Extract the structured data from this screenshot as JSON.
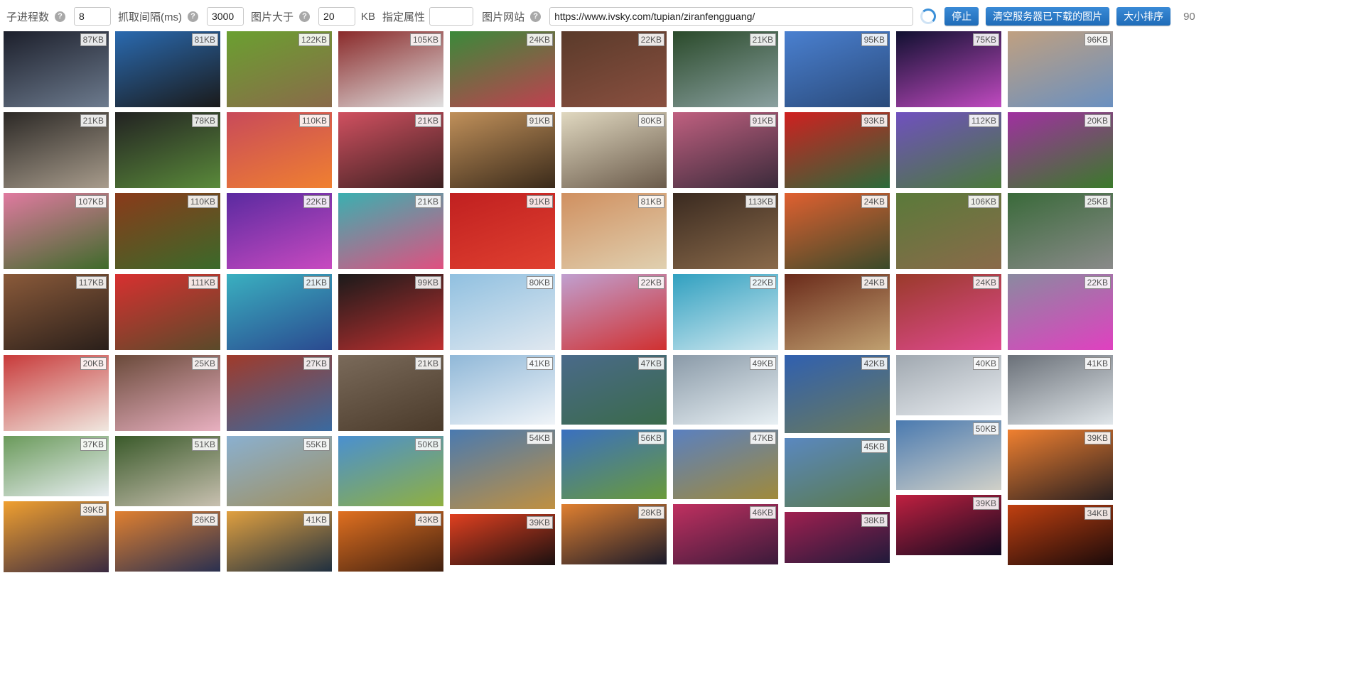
{
  "toolbar": {
    "threads_label": "子进程数",
    "threads_value": "8",
    "interval_label": "抓取间隔(ms)",
    "interval_value": "3000",
    "minsize_label": "图片大于",
    "minsize_value": "20",
    "minsize_unit": "KB",
    "attr_label": "指定属性",
    "attr_value": "",
    "url_label": "图片网站",
    "url_value": "https://www.ivsky.com/tupian/ziranfengguang/",
    "stop_label": "停止",
    "clear_label": "清空服务器已下载的图片",
    "sort_label": "大小排序",
    "count": "90",
    "help_glyph": "?",
    "help_icon": "question-circle-icon",
    "spinner_icon": "loading-spinner-icon"
  },
  "colors": {
    "button": "#2a7cc9",
    "spinner": "#3a8fd8"
  },
  "columns": [
    [
      {
        "size": "87KB",
        "h": 107,
        "c": [
          "#1c1f2b",
          "#6d7b8e"
        ]
      },
      {
        "size": "21KB",
        "h": 107,
        "c": [
          "#2c2926",
          "#a89c8c"
        ]
      },
      {
        "size": "107KB",
        "h": 107,
        "c": [
          "#e07aa0",
          "#3e6b2a"
        ]
      },
      {
        "size": "117KB",
        "h": 107,
        "c": [
          "#8a5a3a",
          "#2a1f1a"
        ]
      },
      {
        "size": "20KB",
        "h": 107,
        "c": [
          "#c83a3a",
          "#f0e8e0"
        ]
      },
      {
        "size": "37KB",
        "h": 85,
        "c": [
          "#6a9a5a",
          "#e8eef2"
        ]
      },
      {
        "size": "39KB",
        "h": 100,
        "c": [
          "#f0a030",
          "#3a2a40"
        ]
      }
    ],
    [
      {
        "size": "81KB",
        "h": 107,
        "c": [
          "#2a6ab0",
          "#1a1a1a"
        ]
      },
      {
        "size": "78KB",
        "h": 107,
        "c": [
          "#222222",
          "#5a8a3a"
        ]
      },
      {
        "size": "110KB",
        "h": 107,
        "c": [
          "#8a3a1a",
          "#3a6a2a"
        ]
      },
      {
        "size": "111KB",
        "h": 107,
        "c": [
          "#d83030",
          "#5a4a2a"
        ]
      },
      {
        "size": "25KB",
        "h": 107,
        "c": [
          "#6a4a3a",
          "#e8b0c0"
        ]
      },
      {
        "size": "51KB",
        "h": 99,
        "c": [
          "#3a5a2a",
          "#c8c0b0"
        ]
      },
      {
        "size": "26KB",
        "h": 85,
        "c": [
          "#e08030",
          "#2a3050"
        ]
      }
    ],
    [
      {
        "size": "122KB",
        "h": 107,
        "c": [
          "#6aa030",
          "#8a6a4a"
        ]
      },
      {
        "size": "110KB",
        "h": 107,
        "c": [
          "#c84a5a",
          "#f08030"
        ]
      },
      {
        "size": "22KB",
        "h": 107,
        "c": [
          "#5a2aa0",
          "#c84ac0"
        ]
      },
      {
        "size": "21KB",
        "h": 107,
        "c": [
          "#3ab0c0",
          "#2a4a90"
        ]
      },
      {
        "size": "27KB",
        "h": 107,
        "c": [
          "#a03a2a",
          "#3a6aa0"
        ]
      },
      {
        "size": "55KB",
        "h": 99,
        "c": [
          "#8ab0d0",
          "#a09060"
        ]
      },
      {
        "size": "41KB",
        "h": 85,
        "c": [
          "#e0a040",
          "#203040"
        ]
      }
    ],
    [
      {
        "size": "105KB",
        "h": 107,
        "c": [
          "#8a2a2a",
          "#e0e0e0"
        ]
      },
      {
        "size": "21KB",
        "h": 107,
        "c": [
          "#d05060",
          "#3a2020"
        ]
      },
      {
        "size": "21KB",
        "h": 107,
        "c": [
          "#3ab0b0",
          "#e05080"
        ]
      },
      {
        "size": "99KB",
        "h": 107,
        "c": [
          "#1a1a1a",
          "#c03030"
        ]
      },
      {
        "size": "21KB",
        "h": 107,
        "c": [
          "#7a6a5a",
          "#4a3a2a"
        ]
      },
      {
        "size": "50KB",
        "h": 99,
        "c": [
          "#4a90d0",
          "#90b040"
        ]
      },
      {
        "size": "43KB",
        "h": 85,
        "c": [
          "#e07020",
          "#402010"
        ]
      }
    ],
    [
      {
        "size": "24KB",
        "h": 107,
        "c": [
          "#3a8a3a",
          "#c04050"
        ]
      },
      {
        "size": "91KB",
        "h": 107,
        "c": [
          "#c0905a",
          "#3a2a1a"
        ]
      },
      {
        "size": "91KB",
        "h": 107,
        "c": [
          "#c02020",
          "#e04030"
        ]
      },
      {
        "size": "80KB",
        "h": 107,
        "c": [
          "#90c0e0",
          "#e0e8f0"
        ]
      },
      {
        "size": "41KB",
        "h": 98,
        "c": [
          "#90b8d8",
          "#f0f4f8"
        ]
      },
      {
        "size": "54KB",
        "h": 112,
        "c": [
          "#4a7ab0",
          "#c09040"
        ]
      },
      {
        "size": "39KB",
        "h": 72,
        "c": [
          "#e04020",
          "#1a1010"
        ]
      }
    ],
    [
      {
        "size": "22KB",
        "h": 107,
        "c": [
          "#5a3a2a",
          "#8a5040"
        ]
      },
      {
        "size": "80KB",
        "h": 107,
        "c": [
          "#e0d8c0",
          "#6a5a4a"
        ]
      },
      {
        "size": "81KB",
        "h": 107,
        "c": [
          "#d09060",
          "#e0d0b0"
        ]
      },
      {
        "size": "22KB",
        "h": 107,
        "c": [
          "#c0a0d0",
          "#d03030"
        ]
      },
      {
        "size": "47KB",
        "h": 98,
        "c": [
          "#4a6a8a",
          "#3a6a4a"
        ]
      },
      {
        "size": "56KB",
        "h": 98,
        "c": [
          "#3a70c0",
          "#6a9a3a"
        ]
      },
      {
        "size": "28KB",
        "h": 85,
        "c": [
          "#e08030",
          "#1a1a2a"
        ]
      }
    ],
    [
      {
        "size": "21KB",
        "h": 107,
        "c": [
          "#2a4a2a",
          "#8aa0a0"
        ]
      },
      {
        "size": "91KB",
        "h": 107,
        "c": [
          "#c06080",
          "#3a2a3a"
        ]
      },
      {
        "size": "113KB",
        "h": 107,
        "c": [
          "#3a2a20",
          "#8a6a4a"
        ]
      },
      {
        "size": "22KB",
        "h": 107,
        "c": [
          "#30a0c0",
          "#d0e8f0"
        ]
      },
      {
        "size": "49KB",
        "h": 98,
        "c": [
          "#8a9aa8",
          "#e8f0f4"
        ]
      },
      {
        "size": "47KB",
        "h": 98,
        "c": [
          "#5a80c0",
          "#a08a3a"
        ]
      },
      {
        "size": "46KB",
        "h": 85,
        "c": [
          "#c03060",
          "#3a1a3a"
        ]
      }
    ],
    [
      {
        "size": "95KB",
        "h": 107,
        "c": [
          "#4a80d0",
          "#2a4a7a"
        ]
      },
      {
        "size": "93KB",
        "h": 107,
        "c": [
          "#d02020",
          "#2a6a3a"
        ]
      },
      {
        "size": "24KB",
        "h": 107,
        "c": [
          "#e06030",
          "#3a4a2a"
        ]
      },
      {
        "size": "24KB",
        "h": 107,
        "c": [
          "#6a2a1a",
          "#c0a070"
        ]
      },
      {
        "size": "42KB",
        "h": 110,
        "c": [
          "#3060b0",
          "#6a7a5a"
        ]
      },
      {
        "size": "45KB",
        "h": 97,
        "c": [
          "#5a88c0",
          "#5a7a4a"
        ]
      },
      {
        "size": "38KB",
        "h": 72,
        "c": [
          "#a02050",
          "#201a3a"
        ]
      }
    ],
    [
      {
        "size": "75KB",
        "h": 107,
        "c": [
          "#101030",
          "#c04ac0"
        ]
      },
      {
        "size": "112KB",
        "h": 107,
        "c": [
          "#7050c0",
          "#4a7a3a"
        ]
      },
      {
        "size": "106KB",
        "h": 107,
        "c": [
          "#5a7a3a",
          "#8a6a4a"
        ]
      },
      {
        "size": "24KB",
        "h": 107,
        "c": [
          "#9a3a2a",
          "#e04a90"
        ]
      },
      {
        "size": "40KB",
        "h": 85,
        "c": [
          "#a0a8b0",
          "#e8ecf0"
        ]
      },
      {
        "size": "50KB",
        "h": 98,
        "c": [
          "#4a7ab0",
          "#d0d0c8"
        ]
      },
      {
        "size": "39KB",
        "h": 85,
        "c": [
          "#c02040",
          "#100a20"
        ]
      }
    ],
    [
      {
        "size": "96KB",
        "h": 107,
        "c": [
          "#c0a080",
          "#6a90c0"
        ]
      },
      {
        "size": "20KB",
        "h": 107,
        "c": [
          "#a030a0",
          "#3a7a2a"
        ]
      },
      {
        "size": "25KB",
        "h": 107,
        "c": [
          "#3a6a3a",
          "#8a8a8a"
        ]
      },
      {
        "size": "22KB",
        "h": 107,
        "c": [
          "#8a8aa0",
          "#e040c0"
        ]
      },
      {
        "size": "41KB",
        "h": 98,
        "c": [
          "#6a7078",
          "#e0e6ea"
        ]
      },
      {
        "size": "39KB",
        "h": 99,
        "c": [
          "#f08030",
          "#2a2020"
        ]
      },
      {
        "size": "34KB",
        "h": 85,
        "c": [
          "#c04010",
          "#1a0a0a"
        ]
      }
    ]
  ]
}
